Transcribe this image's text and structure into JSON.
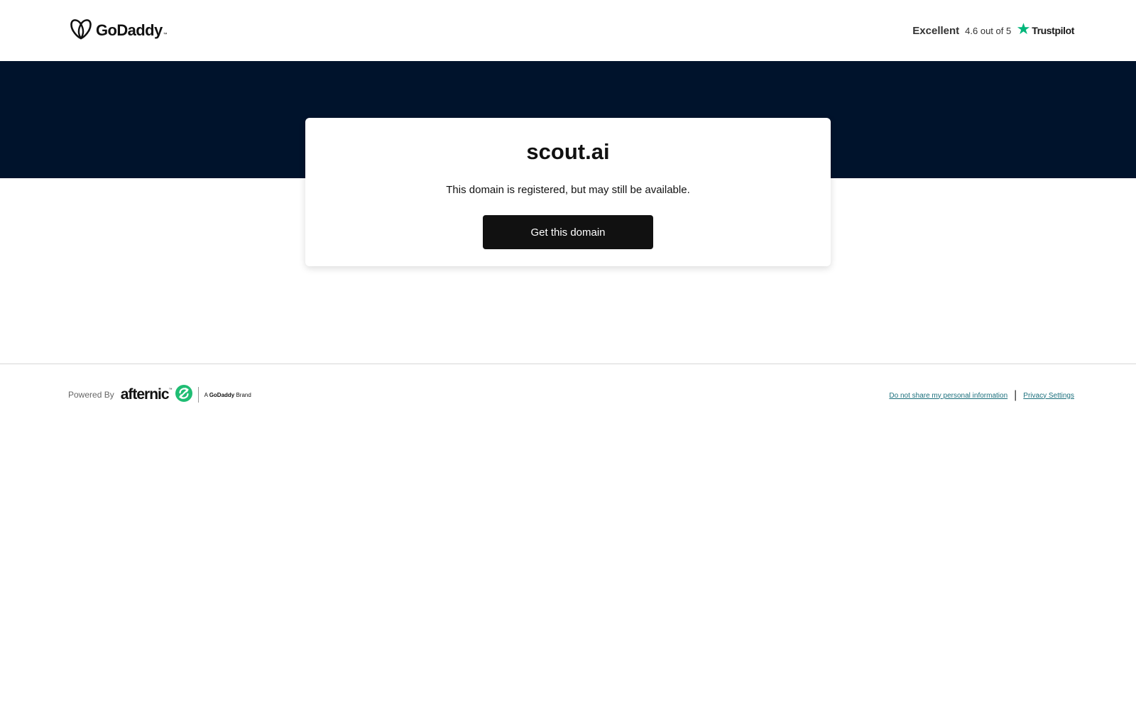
{
  "header": {
    "logo_text": "GoDaddy",
    "logo_tm": "™",
    "rating": {
      "word": "Excellent",
      "score": "4.6 out of 5",
      "provider": "Trustpilot",
      "star_color": "#00b67a"
    }
  },
  "main": {
    "domain": "scout.ai",
    "status": "This domain is registered, but may still be available.",
    "cta_label": "Get this domain"
  },
  "footer": {
    "powered_by": "Powered By",
    "partner_name": "afternic",
    "partner_tm": "™",
    "brand_prefix": "A ",
    "brand_name": "GoDaddy",
    "brand_suffix": " Brand",
    "links": [
      {
        "label": "Do not share my personal information"
      },
      {
        "label": "Privacy Settings"
      }
    ],
    "separator": "|"
  },
  "colors": {
    "hero_bg": "#00132c",
    "cta_bg": "#111111",
    "link": "#1b6f7c",
    "afternic_green": "#1fbd73"
  }
}
